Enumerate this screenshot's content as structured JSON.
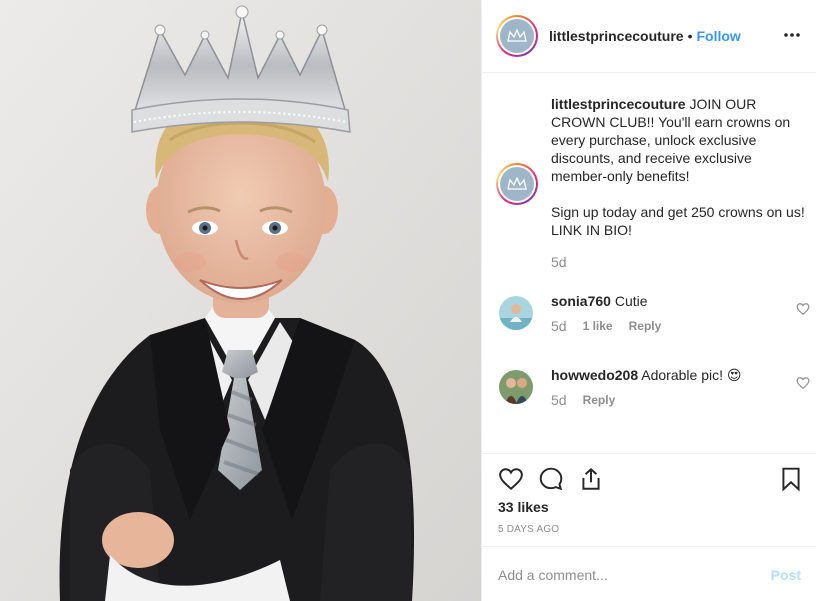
{
  "post": {
    "image_alt": "Smiling toddler wearing a silver crown and a black suit with a grey striped tie"
  },
  "header": {
    "username": "littlestprincecouture",
    "separator": "•",
    "follow_label": "Follow",
    "more_icon": "more-options-icon"
  },
  "caption": {
    "username": "littlestprincecouture",
    "text_1": "JOIN OUR CROWN CLUB!! You'll earn crowns on every purchase, unlock exclusive discounts, and receive exclusive member-only benefits!",
    "text_2": "Sign up today and get 250 crowns on us! LINK IN BIO!",
    "time": "5d"
  },
  "comments": [
    {
      "username": "sonia760",
      "text": "Cutie",
      "time": "5d",
      "likes": "1 like",
      "reply": "Reply"
    },
    {
      "username": "howwedo208",
      "text": "Adorable pic! 😍",
      "time": "5d",
      "reply": "Reply"
    }
  ],
  "actions": {
    "like_icon": "heart-icon",
    "comment_icon": "comment-icon",
    "share_icon": "share-icon",
    "save_icon": "bookmark-icon",
    "likes": "33 likes",
    "posted": "5 DAYS AGO"
  },
  "add_comment": {
    "placeholder": "Add a comment...",
    "post_label": "Post"
  },
  "colors": {
    "accent": "#3897f0",
    "muted": "#8e8e8e",
    "post_disabled": "#b2dffc",
    "text": "#262626",
    "border": "#efefef"
  }
}
